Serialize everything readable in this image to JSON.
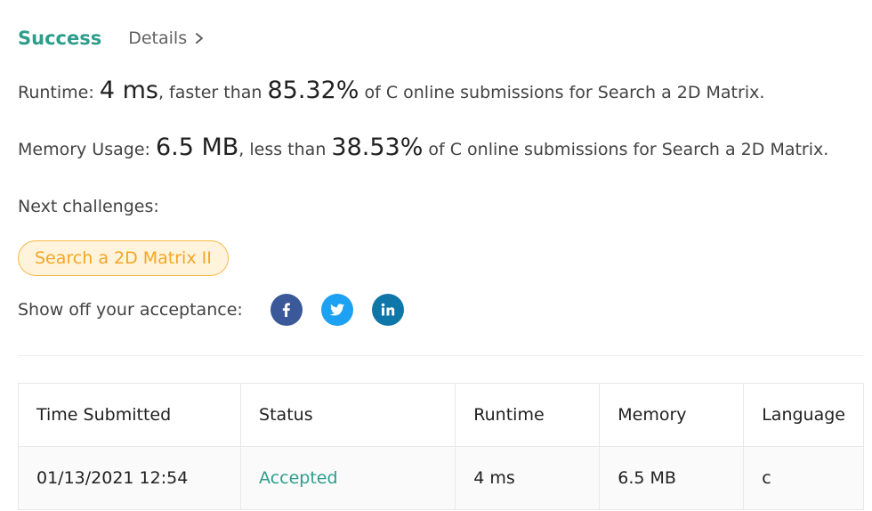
{
  "header": {
    "status": "Success",
    "details_label": "Details"
  },
  "runtime": {
    "label": "Runtime: ",
    "value": "4 ms",
    "comparison": ", faster than ",
    "percent": "85.32%",
    "suffix": " of C online submissions for Search a 2D Matrix."
  },
  "memory": {
    "label": "Memory Usage: ",
    "value": "6.5 MB",
    "comparison": ", less than ",
    "percent": "38.53%",
    "suffix": " of C online submissions for Search a 2D Matrix."
  },
  "next_challenges": {
    "label": "Next challenges:",
    "items": [
      "Search a 2D Matrix II"
    ]
  },
  "share": {
    "label": "Show off your acceptance:",
    "icons": [
      "facebook-icon",
      "twitter-icon",
      "linkedin-icon"
    ]
  },
  "submissions_table": {
    "headers": [
      "Time Submitted",
      "Status",
      "Runtime",
      "Memory",
      "Language"
    ],
    "rows": [
      {
        "time": "01/13/2021 12:54",
        "status": "Accepted",
        "runtime": "4 ms",
        "memory": "6.5 MB",
        "language": "c"
      }
    ]
  },
  "colors": {
    "success": "#2e9d8c",
    "challenge_text": "#f5a623",
    "challenge_bg": "#fff3dc",
    "facebook": "#3b5998",
    "twitter": "#1da1f2",
    "linkedin": "#0e76a8"
  }
}
